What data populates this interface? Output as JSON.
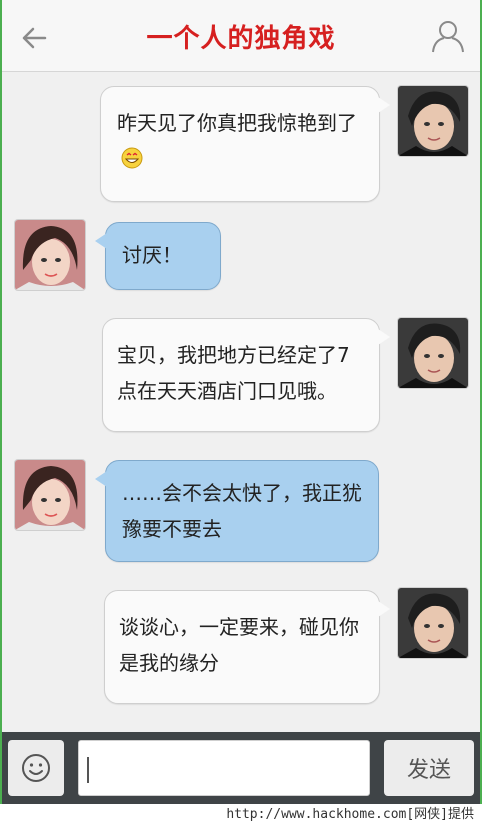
{
  "header": {
    "title": "一个人的独角戏",
    "back_icon": "back-arrow-icon",
    "user_icon": "user-profile-icon"
  },
  "messages": [
    {
      "sender": "me",
      "text": "昨天见了你真把我惊艳到了",
      "has_emoji": true
    },
    {
      "sender": "her",
      "text": "讨厌！"
    },
    {
      "sender": "me",
      "text": "宝贝，我把地方已经定了7点在天天酒店门口见哦。"
    },
    {
      "sender": "her",
      "text": "……会不会太快了，我正犹豫要不要去"
    },
    {
      "sender": "me",
      "text": "谈谈心，一定要来，碰见你是我的缘分"
    }
  ],
  "footer": {
    "emoji_icon": "smiley-face-icon",
    "input_value": "",
    "send_label": "发送"
  },
  "watermark": "http://www.hackhome.com[网侠]提供",
  "colors": {
    "title": "#d62020",
    "her_bubble": "#a9d0ef",
    "me_bubble": "#fafafa",
    "footer_bg": "#3f4447",
    "border": "#4caf50"
  }
}
